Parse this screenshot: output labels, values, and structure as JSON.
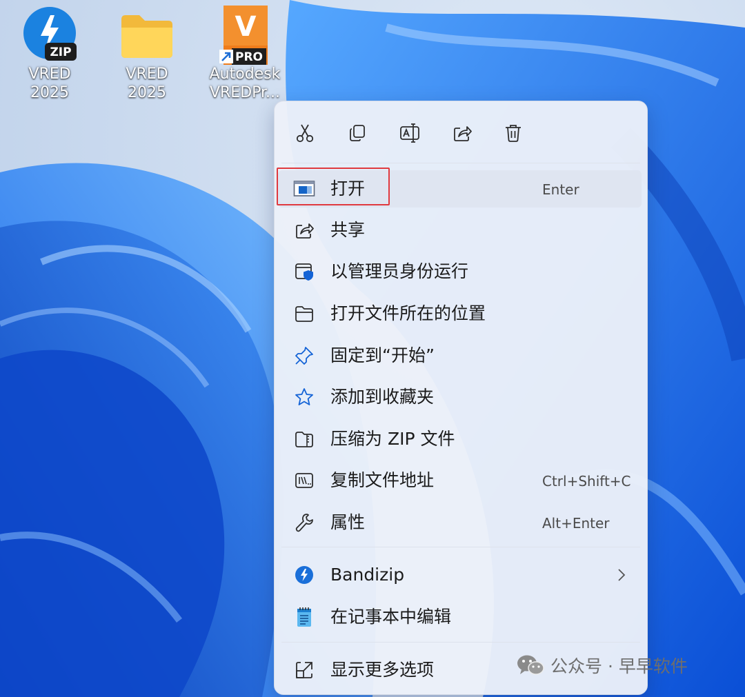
{
  "desktop": {
    "icons": [
      {
        "label": "VRED 2025",
        "icon": "zip-archive-icon",
        "badge": "ZIP"
      },
      {
        "label": "VRED 2025",
        "icon": "folder-icon"
      },
      {
        "label_line1": "Autodesk",
        "label_line2": "VREDPr...",
        "icon": "vred-pro-shortcut-icon",
        "badge": "PRO",
        "glyph": "V"
      }
    ]
  },
  "context_menu": {
    "toolbar": [
      {
        "action": "cut",
        "icon": "scissors-icon"
      },
      {
        "action": "copy",
        "icon": "copy-icon"
      },
      {
        "action": "rename",
        "icon": "rename-icon"
      },
      {
        "action": "share",
        "icon": "share-icon"
      },
      {
        "action": "delete",
        "icon": "trash-icon"
      }
    ],
    "items": [
      {
        "label": "打开",
        "shortcut": "Enter",
        "icon": "open-window-icon"
      },
      {
        "label": "共享",
        "icon": "share-icon"
      },
      {
        "label": "以管理员身份运行",
        "icon": "admin-shield-icon"
      },
      {
        "label": "打开文件所在的位置",
        "icon": "folder-icon"
      },
      {
        "label": "固定到“开始”",
        "icon": "pin-icon"
      },
      {
        "label": "添加到收藏夹",
        "icon": "star-icon"
      },
      {
        "label": "压缩为 ZIP 文件",
        "icon": "zip-folder-icon"
      },
      {
        "label": "复制文件地址",
        "shortcut": "Ctrl+Shift+C",
        "icon": "copy-path-icon"
      },
      {
        "label": "属性",
        "shortcut": "Alt+Enter",
        "icon": "wrench-icon"
      },
      {
        "label": "Bandizip",
        "icon": "bandizip-icon",
        "has_submenu": true
      },
      {
        "label": "在记事本中编辑",
        "icon": "notepad-icon"
      },
      {
        "label": "显示更多选项",
        "icon": "more-options-icon"
      }
    ],
    "hovered_item": "打开"
  },
  "watermark": {
    "text": "公众号 · 早早软件",
    "icon": "wechat-icon"
  },
  "colors": {
    "accent": "#0067c0",
    "highlight_box": "#e0393e",
    "pro_orange": "#f07a1a"
  }
}
